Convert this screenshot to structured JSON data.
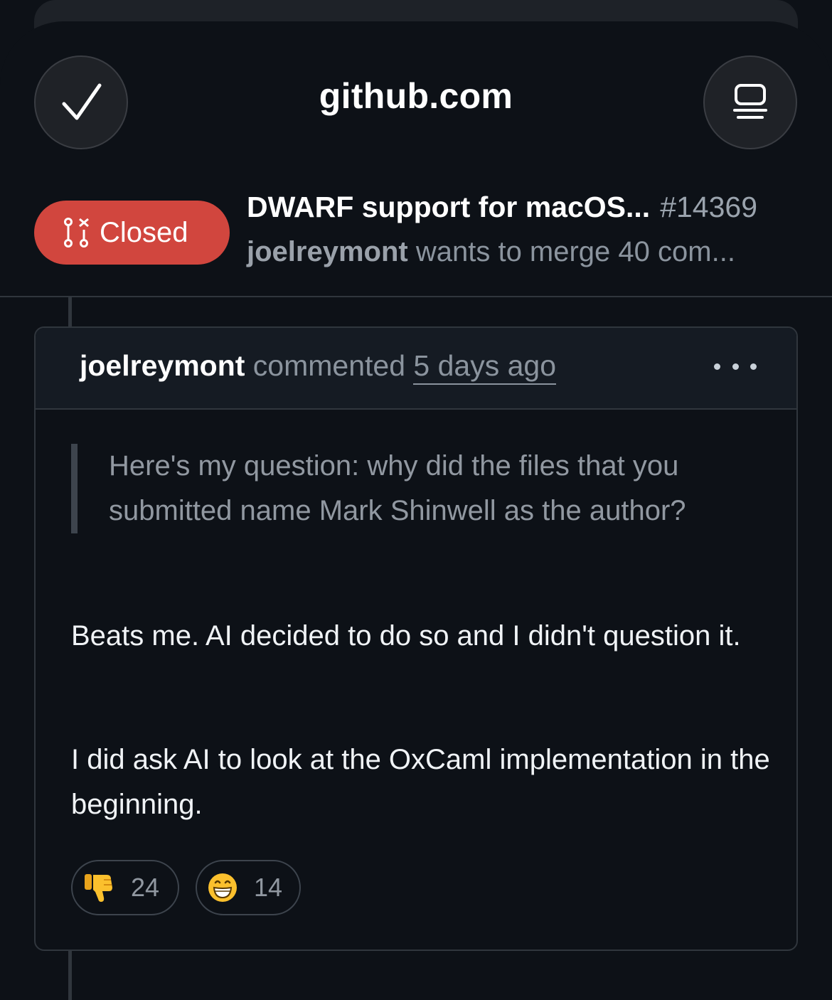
{
  "browser": {
    "domain": "github.com"
  },
  "pr": {
    "status": "Closed",
    "title": "DWARF support for macOS...",
    "number": "#14369",
    "author": "joelreymont",
    "subtitle_rest": "wants to merge 40 com..."
  },
  "comment": {
    "author": "joelreymont",
    "action": "commented",
    "time": "5 days ago",
    "quote": "Here's my question: why did the files that you submitted name Mark Shinwell as the author?",
    "paragraphs": [
      "Beats me. AI decided to do so and I didn't question it.",
      "I did ask AI to look at the OxCaml implementation in the beginning."
    ],
    "reactions": [
      {
        "icon": "thumbs-down-icon",
        "count": "24"
      },
      {
        "icon": "grinning-face-icon",
        "count": "14"
      }
    ]
  },
  "colors": {
    "background": "#0d1117",
    "closed_badge": "#d1463e",
    "border": "#30363d"
  }
}
